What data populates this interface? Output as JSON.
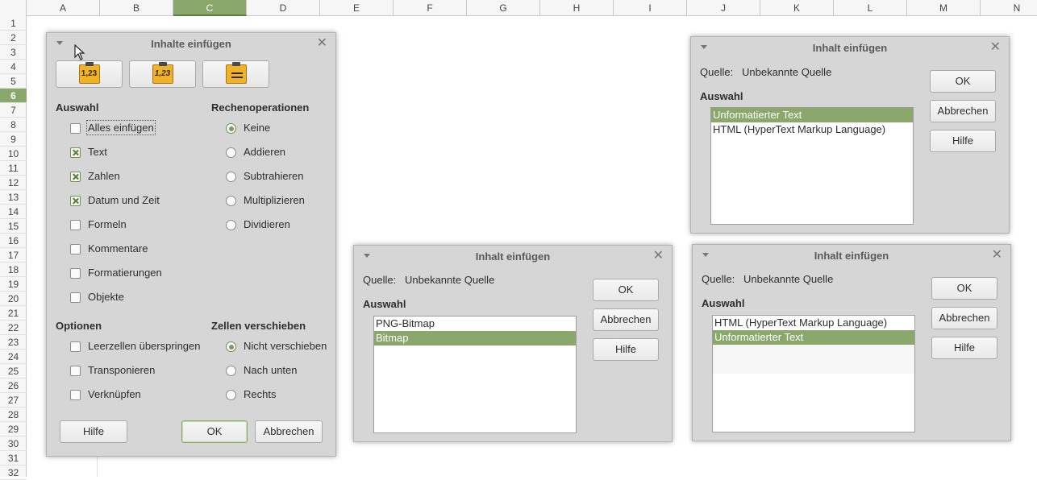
{
  "spreadsheet": {
    "columns": [
      "A",
      "B",
      "C",
      "D",
      "E",
      "F",
      "G",
      "H",
      "I",
      "J",
      "K",
      "L",
      "M",
      "N"
    ],
    "active_column": "C",
    "rows": [
      "1",
      "2",
      "3",
      "4",
      "5",
      "6",
      "7",
      "8",
      "9",
      "10",
      "11",
      "12",
      "13",
      "14",
      "15",
      "16",
      "17",
      "18",
      "19",
      "20",
      "21",
      "22",
      "23",
      "24",
      "25",
      "26",
      "27",
      "28",
      "29",
      "30",
      "31",
      "32"
    ],
    "active_row": "6"
  },
  "dlg_main": {
    "title": "Inhalte einfügen",
    "preset_icons": [
      {
        "icon": "paste-values-icon",
        "text": "1,23"
      },
      {
        "icon": "paste-values-italic-icon",
        "text": "1,23"
      },
      {
        "icon": "paste-formats-icon",
        "text": ""
      }
    ],
    "section_selection": "Auswahl",
    "section_operations": "Rechenoperationen",
    "selection_items": [
      {
        "label": "Alles einfügen",
        "checked": false
      },
      {
        "label": "Text",
        "checked": true
      },
      {
        "label": "Zahlen",
        "checked": true
      },
      {
        "label": "Datum und Zeit",
        "checked": true
      },
      {
        "label": "Formeln",
        "checked": false
      },
      {
        "label": "Kommentare",
        "checked": false
      },
      {
        "label": "Formatierungen",
        "checked": false
      },
      {
        "label": "Objekte",
        "checked": false
      }
    ],
    "operation_items": [
      {
        "label": "Keine",
        "selected": true
      },
      {
        "label": "Addieren",
        "selected": false
      },
      {
        "label": "Subtrahieren",
        "selected": false
      },
      {
        "label": "Multiplizieren",
        "selected": false
      },
      {
        "label": "Dividieren",
        "selected": false
      }
    ],
    "section_options": "Optionen",
    "section_shift": "Zellen verschieben",
    "option_items": [
      {
        "label": "Leerzellen überspringen",
        "checked": false
      },
      {
        "label": "Transponieren",
        "checked": false
      },
      {
        "label": "Verknüpfen",
        "checked": false
      }
    ],
    "shift_items": [
      {
        "label": "Nicht verschieben",
        "selected": true
      },
      {
        "label": "Nach unten",
        "selected": false
      },
      {
        "label": "Rechts",
        "selected": false
      }
    ],
    "help_label": "Hilfe",
    "ok_label": "OK",
    "cancel_label": "Abbrechen"
  },
  "dlg_a": {
    "title": "Inhalt einfügen",
    "source_label": "Quelle:",
    "source_value": "Unbekannte Quelle",
    "selection_label": "Auswahl",
    "items": [
      "Unformatierter Text",
      "HTML (HyperText Markup Language)"
    ],
    "selected_index": 0,
    "ok_label": "OK",
    "cancel_label": "Abbrechen",
    "help_label": "Hilfe"
  },
  "dlg_b": {
    "title": "Inhalt einfügen",
    "source_label": "Quelle:",
    "source_value": "Unbekannte Quelle",
    "selection_label": "Auswahl",
    "items": [
      "PNG-Bitmap",
      "Bitmap"
    ],
    "selected_index": 1,
    "ok_label": "OK",
    "cancel_label": "Abbrechen",
    "help_label": "Hilfe"
  },
  "dlg_c": {
    "title": "Inhalt einfügen",
    "source_label": "Quelle:",
    "source_value": "Unbekannte Quelle",
    "selection_label": "Auswahl",
    "items": [
      "HTML (HyperText Markup Language)",
      "Unformatierter Text"
    ],
    "selected_index": 1,
    "ok_label": "OK",
    "cancel_label": "Abbrechen",
    "help_label": "Hilfe"
  }
}
